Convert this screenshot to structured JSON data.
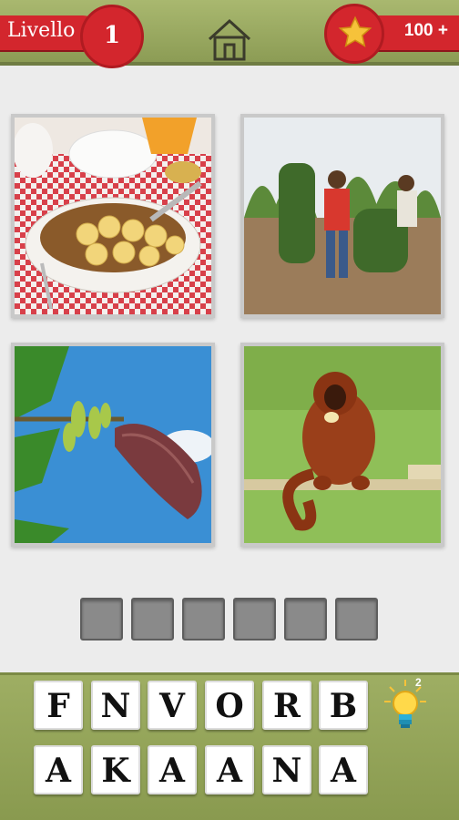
{
  "header": {
    "level_label": "Livello",
    "level_number": "1",
    "coins": "100 +"
  },
  "hint": {
    "count": "2"
  },
  "pictures": [
    {
      "subject": "banana cereal bowl"
    },
    {
      "subject": "banana plantation"
    },
    {
      "subject": "banana flower"
    },
    {
      "subject": "monkey eating banana"
    }
  ],
  "answer_slots": 6,
  "letters": [
    "F",
    "N",
    "V",
    "O",
    "R",
    "B",
    "A",
    "K",
    "A",
    "A",
    "N",
    "A"
  ],
  "colors": {
    "topbar": "#9aab60",
    "accent_red": "#d3262d",
    "star": "#f6c23a",
    "slot": "#8a8a8a"
  }
}
